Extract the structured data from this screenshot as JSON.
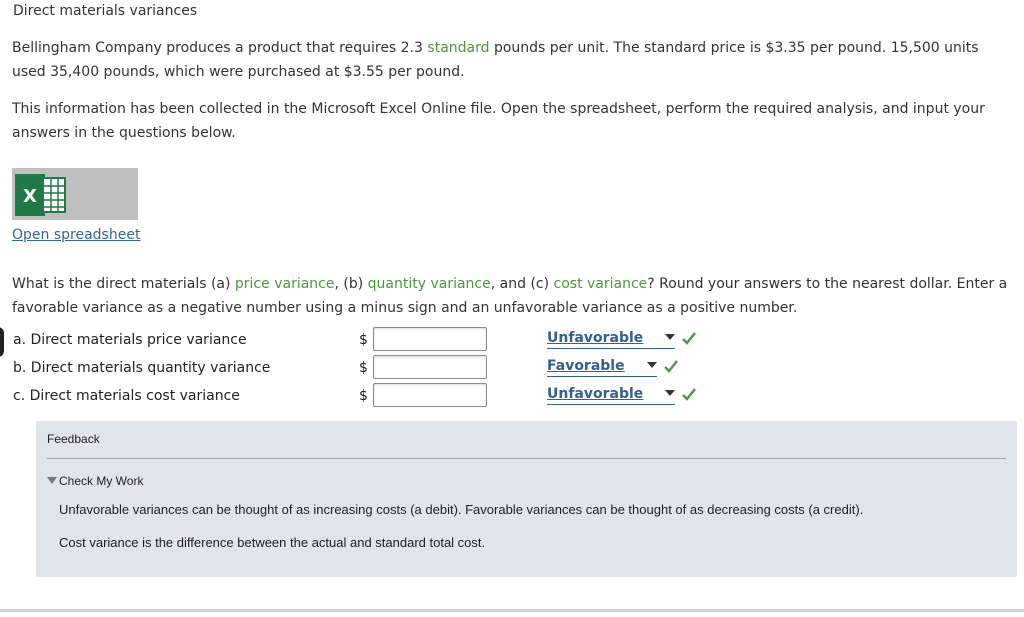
{
  "page_title": "Direct materials variances",
  "problem": {
    "p1_before": "Bellingham Company produces a product that requires 2.3 ",
    "p1_term": "standard",
    "p1_after": " pounds per unit. The standard price is $3.35 per pound. 15,500 units used 35,400 pounds, which were purchased at $3.55 per pound.",
    "p2": "This information has been collected in the Microsoft Excel Online file. Open the spreadsheet, perform the required analysis, and input your answers in the questions below."
  },
  "spreadsheet": {
    "icon": "excel-icon",
    "link_label": "Open spreadsheet"
  },
  "question": {
    "s1": "What is the direct materials (a) ",
    "t1": "price variance",
    "s2": ", (b) ",
    "t2": "quantity variance",
    "s3": ", and (c) ",
    "t3": "cost variance",
    "s4": "? Round your answers to the nearest dollar. Enter a favorable variance as a negative number using a minus sign and an unfavorable variance as a positive number."
  },
  "rows": [
    {
      "label": "a. Direct materials price variance",
      "currency": "$",
      "value": "",
      "selection": "Unfavorable",
      "status_icon": "checkmark-icon"
    },
    {
      "label": "b. Direct materials quantity variance",
      "currency": "$",
      "value": "",
      "selection": "Favorable",
      "status_icon": "checkmark-icon"
    },
    {
      "label": "c. Direct materials cost variance",
      "currency": "$",
      "value": "",
      "selection": "Unfavorable",
      "status_icon": "checkmark-icon"
    }
  ],
  "feedback": {
    "title": "Feedback",
    "check_label": "Check My Work",
    "line1": "Unfavorable variances can be thought of as increasing costs (a debit). Favorable variances can be thought of as decreasing costs (a credit).",
    "line2": "Cost variance is the difference between the actual and standard total cost."
  },
  "colors": {
    "term_green": "#4a9a3a",
    "link_blue": "#336699",
    "select_blue": "#2f6096",
    "check_green": "#4a9a3a",
    "feedback_bg": "#dfe5ea"
  }
}
